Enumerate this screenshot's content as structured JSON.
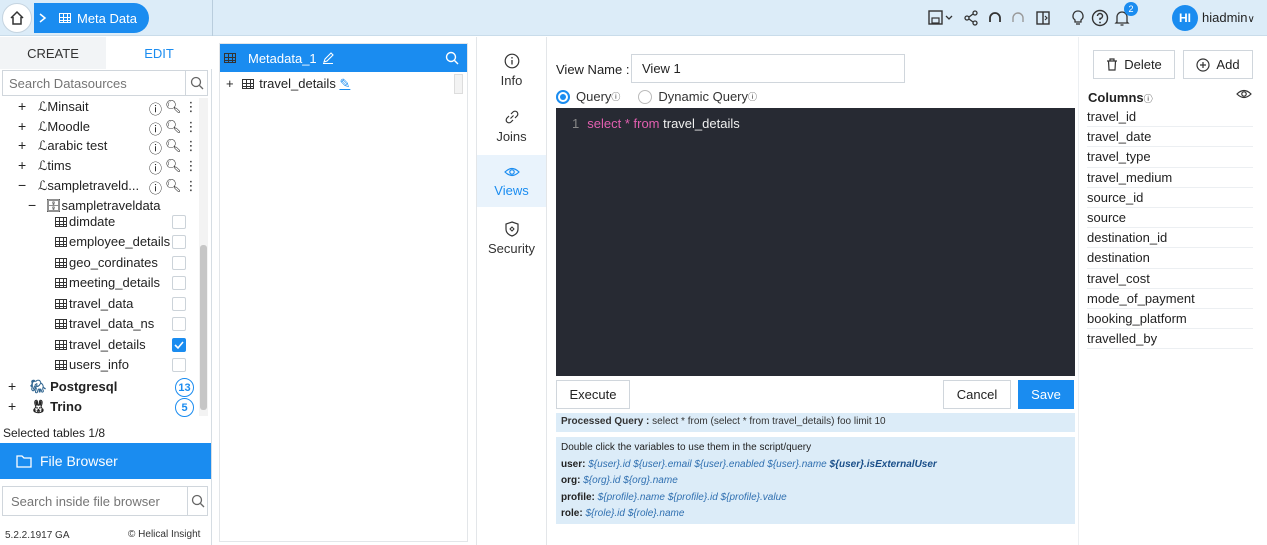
{
  "breadcrumb": {
    "home_icon": "home-icon",
    "current": "Meta Data"
  },
  "topbar": {
    "icons": [
      "save-dropdown-icon",
      "share-icon",
      "undo-icon",
      "redo-icon",
      "preview-icon",
      "idea-icon",
      "help-icon",
      "notification-icon"
    ],
    "notification_count": "2",
    "avatar_initials": "HI",
    "username": "hiadmin"
  },
  "left": {
    "tabs": {
      "create": "CREATE",
      "edit": "EDIT"
    },
    "search_placeholder": "Search Datasources",
    "tree": [
      {
        "sign": "+",
        "label": "Minsait",
        "type": "link"
      },
      {
        "sign": "+",
        "label": "Moodle",
        "type": "link"
      },
      {
        "sign": "+",
        "label": "arabic test",
        "type": "link"
      },
      {
        "sign": "+",
        "label": "tims",
        "type": "link"
      },
      {
        "sign": "−",
        "label": "sampletraveld...",
        "type": "link"
      },
      {
        "sign": "−",
        "label": "sampletraveldata",
        "type": "schema"
      }
    ],
    "tables": [
      {
        "label": "dimdate",
        "checked": false
      },
      {
        "label": "employee_details",
        "checked": false
      },
      {
        "label": "geo_cordinates",
        "checked": false
      },
      {
        "label": "meeting_details",
        "checked": false
      },
      {
        "label": "travel_data",
        "checked": false
      },
      {
        "label": "travel_data_ns",
        "checked": false
      },
      {
        "label": "travel_details",
        "checked": true
      },
      {
        "label": "users_info",
        "checked": false
      }
    ],
    "groups": [
      {
        "label": "Postgresql",
        "count": "13"
      },
      {
        "label": "Trino",
        "count": "5"
      }
    ],
    "selected_tables": "Selected tables 1/8",
    "file_browser_label": "File Browser",
    "file_search_placeholder": "Search inside file browser",
    "version": "5.2.2.1917 GA",
    "brand": "Helical Insight"
  },
  "metadata": {
    "title": "Metadata_1",
    "table": "travel_details"
  },
  "nav": [
    {
      "label": "Info",
      "icon": "info-icon",
      "active": false
    },
    {
      "label": "Joins",
      "icon": "link-icon",
      "active": false
    },
    {
      "label": "Views",
      "icon": "eye-icon",
      "active": true
    },
    {
      "label": "Security",
      "icon": "shield-icon",
      "active": false
    }
  ],
  "view": {
    "name_label": "View Name",
    "name_value": "View 1",
    "query_label": "Query",
    "dynamic_label": "Dynamic Query",
    "editor": {
      "line_no": "1",
      "kw_select": "select",
      "star": "*",
      "kw_from": "from",
      "table": "travel_details"
    },
    "execute": "Execute",
    "cancel": "Cancel",
    "save": "Save",
    "processed_label": "Processed Query :",
    "processed_value": "select * from (select * from travel_details) foo limit 10",
    "vars_title": "Double click the variables to use them in the script/query",
    "vars": {
      "user_label": "user:",
      "user_values": "${user}.id ${user}.email ${user}.enabled ${user}.name",
      "user_external": "${user}.isExternalUser",
      "org_label": "org:",
      "org_values": "${org}.id ${org}.name",
      "profile_label": "profile:",
      "profile_values": "${profile}.name ${profile}.id ${profile}.value",
      "role_label": "role:",
      "role_values": "${role}.id ${role}.name"
    }
  },
  "actions": {
    "delete": "Delete",
    "add": "Add"
  },
  "columns": {
    "title": "Columns",
    "items": [
      "travel_id",
      "travel_date",
      "travel_type",
      "travel_medium",
      "source_id",
      "source",
      "destination_id",
      "destination",
      "travel_cost",
      "mode_of_payment",
      "booking_platform",
      "travelled_by"
    ]
  },
  "colors": {
    "accent": "#1a8cf0",
    "editor_bg": "#272a33",
    "keyword": "#e25fb0"
  }
}
